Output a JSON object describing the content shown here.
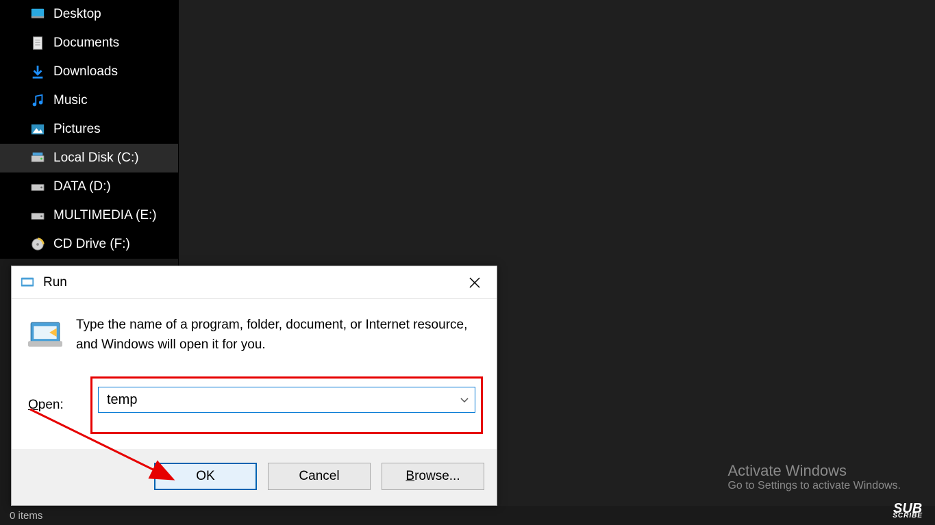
{
  "sidebar": {
    "items": [
      {
        "label": "Desktop",
        "icon": "desktop",
        "selected": false
      },
      {
        "label": "Documents",
        "icon": "documents",
        "selected": false
      },
      {
        "label": "Downloads",
        "icon": "downloads",
        "selected": false
      },
      {
        "label": "Music",
        "icon": "music",
        "selected": false
      },
      {
        "label": "Pictures",
        "icon": "pictures",
        "selected": false
      },
      {
        "label": "Local Disk (C:)",
        "icon": "drive",
        "selected": true
      },
      {
        "label": "DATA (D:)",
        "icon": "drive",
        "selected": false
      },
      {
        "label": "MULTIMEDIA (E:)",
        "icon": "drive",
        "selected": false
      },
      {
        "label": "CD Drive (F:)",
        "icon": "cd",
        "selected": false
      }
    ]
  },
  "statusbar": {
    "text": "0 items"
  },
  "watermark": {
    "title": "Activate Windows",
    "sub": "Go to Settings to activate Windows."
  },
  "subscribe": {
    "top": "SUB",
    "bottom": "SCRIBE"
  },
  "run": {
    "title": "Run",
    "description": "Type the name of a program, folder, document, or Internet resource, and Windows will open it for you.",
    "open_label_prefix": "O",
    "open_label_rest": "pen:",
    "input_value": "temp",
    "ok_label": "OK",
    "cancel_label": "Cancel",
    "browse_prefix": "B",
    "browse_rest": "rowse..."
  }
}
